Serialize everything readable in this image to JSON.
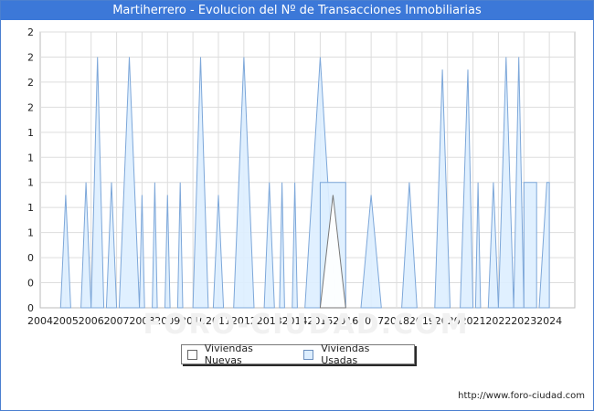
{
  "title": "Martiherrero - Evolucion del Nº de Transacciones Inmobiliarias",
  "source": "http://www.foro-ciudad.com",
  "watermark": "FORO-CIUDAD.COM",
  "legend": {
    "new_label": "Viviendas Nuevas",
    "used_label": "Viviendas Usadas"
  },
  "colors": {
    "title_bg": "#3c78d8",
    "used_fill": "#ddeeff",
    "used_line": "#7da7d9",
    "new_fill": "#ffffff",
    "new_line": "#777777",
    "grid": "#dddddd"
  },
  "chart_data": {
    "type": "area",
    "title": "Martiherrero - Evolucion del Nº de Transacciones Inmobiliarias",
    "xlabel": "",
    "ylabel": "",
    "xlim": [
      2004,
      2025
    ],
    "ylim": [
      0,
      2.2
    ],
    "grid": true,
    "legend_position": "bottom",
    "x_ticks": [
      "2004",
      "2005",
      "2006",
      "2007",
      "2008",
      "2009",
      "2010",
      "2011",
      "2012",
      "2013",
      "2014",
      "2015",
      "2016",
      "2017",
      "2018",
      "2019",
      "2020",
      "2021",
      "2022",
      "2023",
      "2024"
    ],
    "y_tick_labels": [
      "0",
      "0",
      "0",
      "1",
      "1",
      "1",
      "1",
      "1",
      "2",
      "2",
      "2",
      "2"
    ],
    "series": [
      {
        "name": "Viviendas Nuevas",
        "points": [
          [
            2015,
            0
          ],
          [
            2015.5,
            0.9
          ],
          [
            2016,
            0
          ]
        ]
      },
      {
        "name": "Viviendas Usadas",
        "points": [
          [
            2004.8,
            0
          ],
          [
            2005.0,
            0.9
          ],
          [
            2005.2,
            0
          ],
          [
            2005.6,
            0
          ],
          [
            2005.8,
            1.0
          ],
          [
            2006.0,
            0
          ],
          [
            2006.0,
            0
          ],
          [
            2006.25,
            2.0
          ],
          [
            2006.5,
            0
          ],
          [
            2006.6,
            0
          ],
          [
            2006.8,
            1.0
          ],
          [
            2007.0,
            0
          ],
          [
            2007.1,
            0
          ],
          [
            2007.5,
            2.0
          ],
          [
            2007.9,
            0
          ],
          [
            2007.9,
            0
          ],
          [
            2008.0,
            0.9
          ],
          [
            2008.1,
            0
          ],
          [
            2008.4,
            0
          ],
          [
            2008.5,
            1.0
          ],
          [
            2008.6,
            0
          ],
          [
            2008.9,
            0
          ],
          [
            2009.0,
            0.9
          ],
          [
            2009.1,
            0
          ],
          [
            2009.4,
            0
          ],
          [
            2009.5,
            1.0
          ],
          [
            2009.6,
            0
          ],
          [
            2010.0,
            0
          ],
          [
            2010.3,
            2.0
          ],
          [
            2010.6,
            0
          ],
          [
            2010.8,
            0
          ],
          [
            2011.0,
            0.9
          ],
          [
            2011.2,
            0
          ],
          [
            2011.6,
            0
          ],
          [
            2012.0,
            2.0
          ],
          [
            2012.4,
            0
          ],
          [
            2012.8,
            0
          ],
          [
            2013.0,
            1.0
          ],
          [
            2013.2,
            0
          ],
          [
            2013.4,
            0
          ],
          [
            2013.5,
            1.0
          ],
          [
            2013.6,
            0
          ],
          [
            2013.9,
            0
          ],
          [
            2014.0,
            1.0
          ],
          [
            2014.1,
            0
          ],
          [
            2014.4,
            0
          ],
          [
            2015.0,
            2.0
          ],
          [
            2015.6,
            0
          ],
          [
            2015.0,
            0
          ],
          [
            2015.0,
            1.0
          ],
          [
            2016.0,
            1.0
          ],
          [
            2016.0,
            0
          ],
          [
            2016.6,
            0
          ],
          [
            2017.0,
            0.9
          ],
          [
            2017.4,
            0
          ],
          [
            2018.2,
            0
          ],
          [
            2018.5,
            1.0
          ],
          [
            2018.8,
            0
          ],
          [
            2019.5,
            0
          ],
          [
            2019.8,
            1.9
          ],
          [
            2020.1,
            0
          ],
          [
            2020.5,
            0
          ],
          [
            2020.8,
            1.9
          ],
          [
            2021.0,
            0
          ],
          [
            2021.1,
            0
          ],
          [
            2021.2,
            1.0
          ],
          [
            2021.3,
            0
          ],
          [
            2021.6,
            0
          ],
          [
            2021.8,
            1.0
          ],
          [
            2022.0,
            0
          ],
          [
            2022.0,
            0
          ],
          [
            2022.3,
            2.0
          ],
          [
            2022.6,
            0
          ],
          [
            2022.6,
            0
          ],
          [
            2022.8,
            2.0
          ],
          [
            2023.0,
            0
          ],
          [
            2023.0,
            0
          ],
          [
            2023.0,
            1.0
          ],
          [
            2023.5,
            1.0
          ],
          [
            2023.5,
            0
          ],
          [
            2023.6,
            0
          ],
          [
            2023.9,
            1.0
          ],
          [
            2024.0,
            1.0
          ],
          [
            2024.0,
            0
          ]
        ]
      }
    ]
  }
}
